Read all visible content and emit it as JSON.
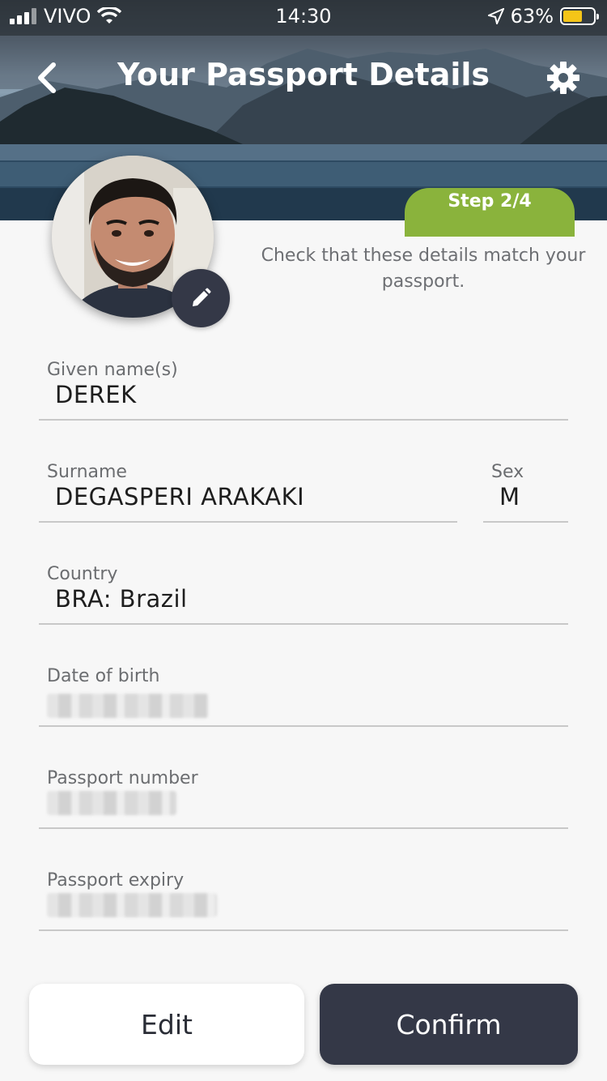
{
  "status_bar": {
    "carrier": "VIVO",
    "time": "14:30",
    "battery_percent": "63%",
    "battery_level": 0.63,
    "icons": [
      "signal-icon",
      "wifi-icon",
      "location-icon",
      "battery-icon"
    ]
  },
  "header": {
    "title": "Your Passport Details",
    "back_icon": "chevron-left-icon",
    "settings_icon": "gear-icon",
    "step_label": "Step 2/4"
  },
  "profile": {
    "edit_icon": "pencil-icon",
    "instruction": "Check that these details match your passport."
  },
  "fields": {
    "given_names": {
      "label": "Given name(s)",
      "value": "DEREK"
    },
    "surname": {
      "label": "Surname",
      "value": "DEGASPERI ARAKAKI"
    },
    "sex": {
      "label": "Sex",
      "value": "M"
    },
    "country": {
      "label": "Country",
      "value": "BRA: Brazil"
    },
    "date_of_birth": {
      "label": "Date of birth"
    },
    "passport_number": {
      "label": "Passport number"
    },
    "passport_expiry": {
      "label": "Passport expiry"
    }
  },
  "actions": {
    "edit_label": "Edit",
    "confirm_label": "Confirm"
  },
  "colors": {
    "accent_green": "#8ab33c",
    "dark_button": "#343847",
    "background": "#f7f7f7",
    "battery_fill": "#f5c518"
  }
}
